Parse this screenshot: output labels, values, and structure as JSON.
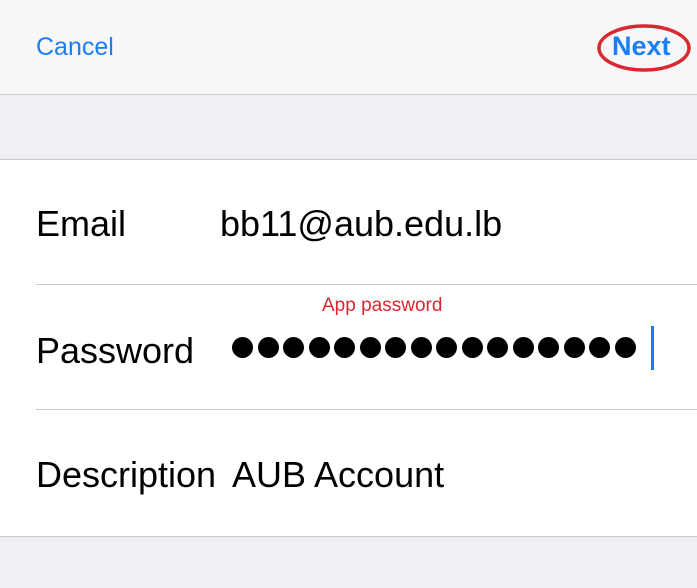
{
  "navbar": {
    "cancel_label": "Cancel",
    "next_label": "Next"
  },
  "form": {
    "email": {
      "label": "Email",
      "value": "bb11@aub.edu.lb"
    },
    "password": {
      "label": "Password",
      "masked_length": 16,
      "annotation": "App password"
    },
    "description": {
      "label": "Description",
      "value": "AUB Account"
    }
  },
  "colors": {
    "accent": "#1a7ef5",
    "annotation": "#d9282f",
    "background": "#efeff4",
    "separator": "#c8c7cc"
  }
}
